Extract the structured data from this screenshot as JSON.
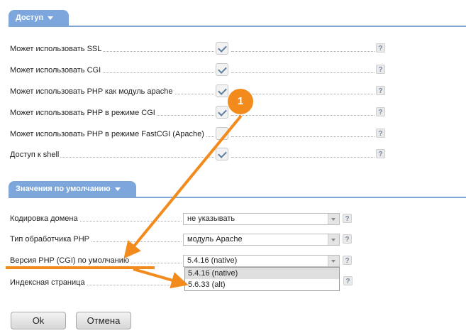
{
  "access": {
    "title": "Доступ",
    "rows": [
      {
        "label": "Может использовать SSL",
        "checked": true
      },
      {
        "label": "Может использовать CGI",
        "checked": true
      },
      {
        "label": "Может использовать PHP как модуль apache",
        "checked": true
      },
      {
        "label": "Может использовать PHP в режиме CGI",
        "checked": true
      },
      {
        "label": "Может использовать PHP в режиме FastCGI (Apache)",
        "checked": false
      },
      {
        "label": "Доступ к shell",
        "checked": true
      }
    ],
    "help_glyph": "?"
  },
  "defaults": {
    "title": "Значения по умолчанию",
    "rows": [
      {
        "label": "Кодировка домена",
        "value": "не указывать"
      },
      {
        "label": "Тип обработчика PHP",
        "value": "модуль Apache"
      },
      {
        "label": "Версия PHP (CGI) по умолчанию",
        "value": "5.4.16 (native)"
      },
      {
        "label": "Индексная страница",
        "value": ""
      }
    ],
    "dropdown_options": [
      "5.4.16 (native)",
      "5.6.33 (alt)"
    ],
    "selected_option": "5.4.16 (native)"
  },
  "buttons": {
    "ok": "Ok",
    "cancel": "Отмена"
  },
  "annotation": {
    "badge_number": "1"
  },
  "colors": {
    "accent": "#7da7dc",
    "arrow": "#f28a1c"
  }
}
